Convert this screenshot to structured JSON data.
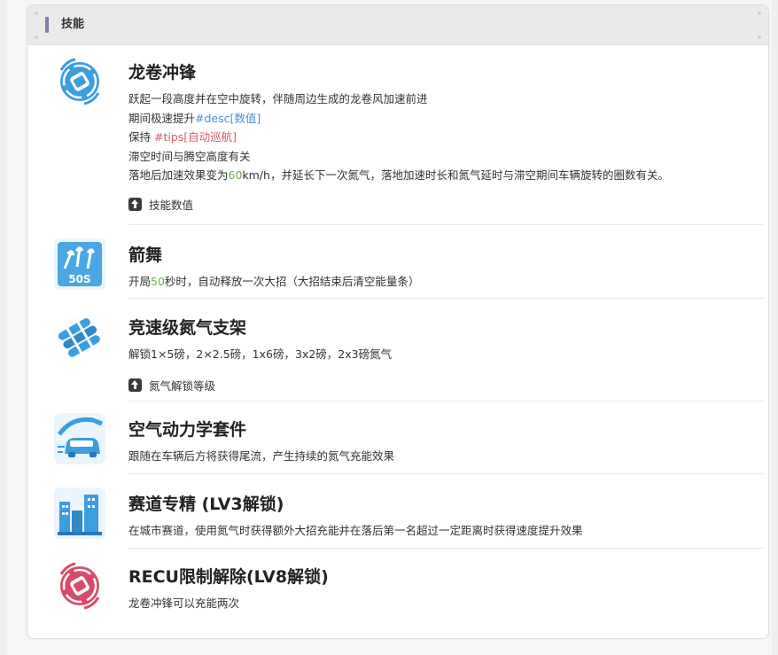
{
  "section": {
    "title": "技能"
  },
  "skills": [
    {
      "name": "龙卷冲锋",
      "icon": "tornado-icon",
      "line1": "跃起一段高度并在空中旋转，伴随周边生成的龙卷风加速前进",
      "line2_prefix": "期间极速提升",
      "line2_tag": "#desc[数值]",
      "line3_prefix": "保持 ",
      "line3_tag": "#tips[自动巡航]",
      "line4": "滞空时间与腾空高度有关",
      "line5_prefix": "落地后加速效果变为",
      "line5_num": "60",
      "line5_suffix": "km/h，并延长下一次氮气，落地加速时长和氮气延时与滞空期间车辆旋转的圈数有关。",
      "button": "技能数值"
    },
    {
      "name": "箭舞",
      "icon": "arrow-dance-icon",
      "badge": "50S",
      "line1_prefix": "开局",
      "line1_num": "50",
      "line1_suffix": "秒时，自动释放一次大招（大招结束后清空能量条）"
    },
    {
      "name": "竞速级氮气支架",
      "icon": "nitro-rack-icon",
      "line1": "解锁1×5磅，2×2.5磅，1x6磅，3x2磅，2x3磅氮气",
      "button": "氮气解锁等级"
    },
    {
      "name": "空气动力学套件",
      "icon": "aero-kit-icon",
      "line1": "跟随在车辆后方将获得尾流，产生持续的氮气充能效果"
    },
    {
      "name": "赛道专精 (LV3解锁)",
      "icon": "city-track-icon",
      "line1": "在城市赛道，使用氮气时获得额外大招充能并在落后第一名超过一定距离时获得速度提升效果"
    },
    {
      "name": "RECU限制解除(LV8解锁)",
      "icon": "recu-tornado-icon",
      "line1": "龙卷冲锋可以充能两次"
    }
  ],
  "colors": {
    "accent_bar": "#7a7fb0",
    "desc_tag": "#4a8fd0",
    "tips_tag": "#d55a6a",
    "number": "#6ab04c",
    "icon_blue": "#3a9ee0",
    "icon_red": "#d94a6a"
  }
}
